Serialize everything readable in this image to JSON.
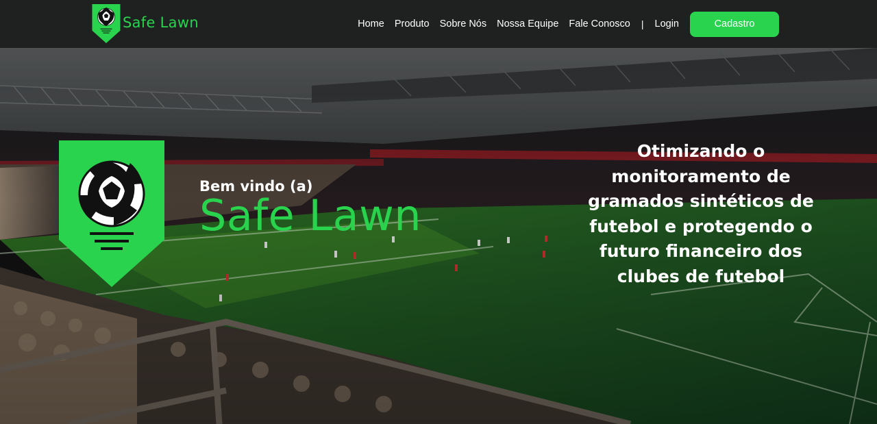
{
  "brand": {
    "name": "Safe Lawn",
    "accent_color": "#2ad34e",
    "logo_icon": "soccer-ball-shield-icon"
  },
  "nav": {
    "items": [
      {
        "label": "Home"
      },
      {
        "label": "Produto"
      },
      {
        "label": "Sobre Nós"
      },
      {
        "label": "Nossa Equipe"
      },
      {
        "label": "Fale Conosco"
      }
    ],
    "separator": "|",
    "login_label": "Login",
    "signup_label": "Cadastro"
  },
  "hero": {
    "background": "football-stadium-photo",
    "welcome": "Bem vindo (a)",
    "title": "Safe Lawn",
    "tagline": "Otimizando o monitoramento de gramados sintéticos de futebol e protegendo o futuro financeiro dos clubes de futebol"
  }
}
